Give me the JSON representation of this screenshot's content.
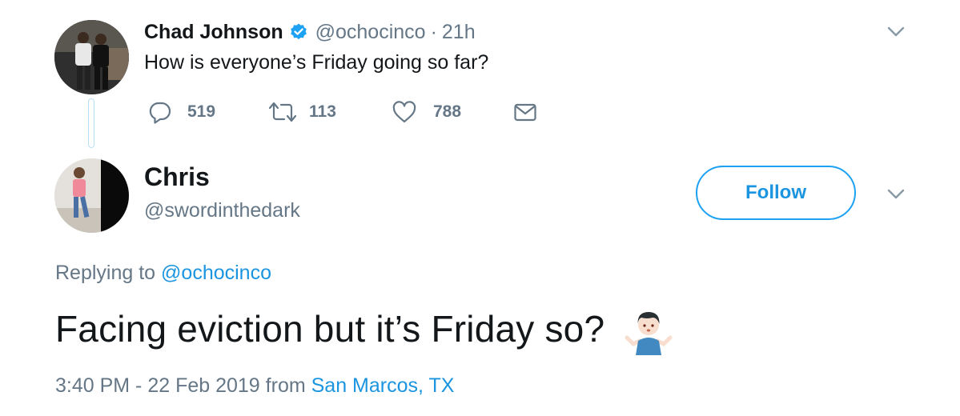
{
  "parent_tweet": {
    "author_name": "Chad Johnson",
    "handle": "@ochocinco",
    "separator": "·",
    "time": "21h",
    "text": "How is everyone’s Friday going so far?",
    "icons": {
      "verified": "verified-badge-icon",
      "more": "chevron-down-icon",
      "reply": "reply-icon",
      "retweet": "retweet-icon",
      "like": "heart-icon",
      "dm": "envelope-icon"
    },
    "actions": {
      "replies": "519",
      "retweets": "113",
      "likes": "788"
    }
  },
  "reply_tweet": {
    "author_name": "Chris",
    "handle": "@swordinthedark",
    "follow_label": "Follow",
    "replying_to_prefix": "Replying to",
    "replying_to_handle": "@ochocinco",
    "text": "Facing eviction but it’s Friday so?",
    "emoji": "person-shrugging-emoji",
    "timestamp": "3:40 PM - 22 Feb 2019",
    "from_label": "from",
    "location": "San Marcos, TX"
  },
  "colors": {
    "link_blue": "#1b95e0",
    "follow_border": "#1da1f2",
    "secondary_text": "#657786",
    "primary_text": "#14171a",
    "thread_line": "#b8dff3"
  }
}
